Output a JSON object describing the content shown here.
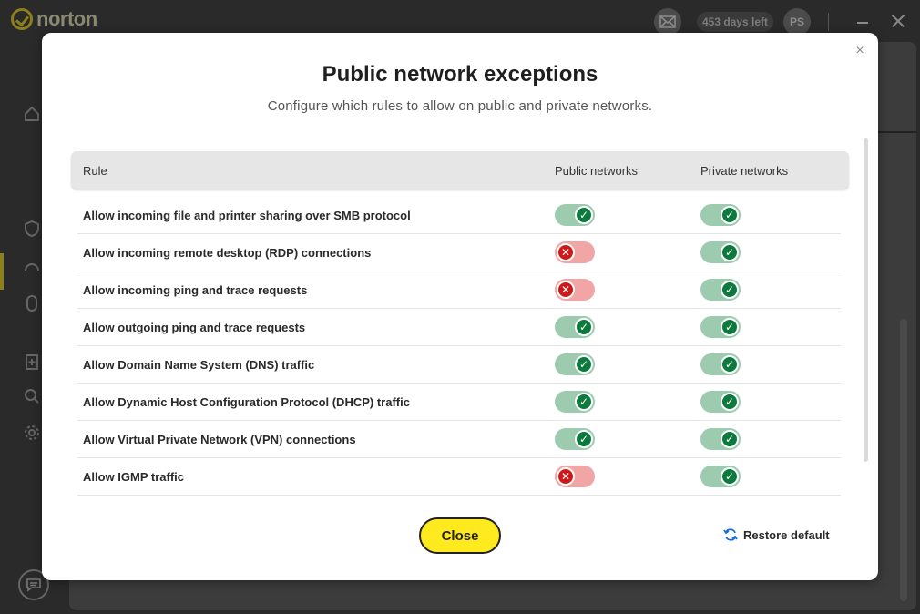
{
  "app": {
    "brand": "norton",
    "days_left": "453 days left",
    "avatar_initials": "PS"
  },
  "modal": {
    "title": "Public network exceptions",
    "subtitle": "Configure which rules to allow on public and private networks.",
    "close_x": "×",
    "columns": {
      "rule": "Rule",
      "public": "Public networks",
      "private": "Private networks"
    },
    "rows": [
      {
        "label": "Allow incoming file and printer sharing over SMB protocol",
        "public": true,
        "private": true
      },
      {
        "label": "Allow incoming remote desktop (RDP) connections",
        "public": false,
        "private": true
      },
      {
        "label": "Allow incoming ping and trace requests",
        "public": false,
        "private": true
      },
      {
        "label": "Allow outgoing ping and trace requests",
        "public": true,
        "private": true
      },
      {
        "label": "Allow Domain Name System (DNS) traffic",
        "public": true,
        "private": true
      },
      {
        "label": "Allow Dynamic Host Configuration Protocol (DHCP) traffic",
        "public": true,
        "private": true
      },
      {
        "label": "Allow Virtual Private Network (VPN) connections",
        "public": true,
        "private": true
      },
      {
        "label": "Allow IGMP traffic",
        "public": false,
        "private": true
      }
    ],
    "close_label": "Close",
    "restore_label": "Restore default"
  },
  "colors": {
    "accent_yellow": "#ffe91f",
    "toggle_on": "#0c7a3c",
    "toggle_off": "#d01818"
  },
  "icons": {
    "on": "check-icon",
    "off": "x-icon"
  }
}
